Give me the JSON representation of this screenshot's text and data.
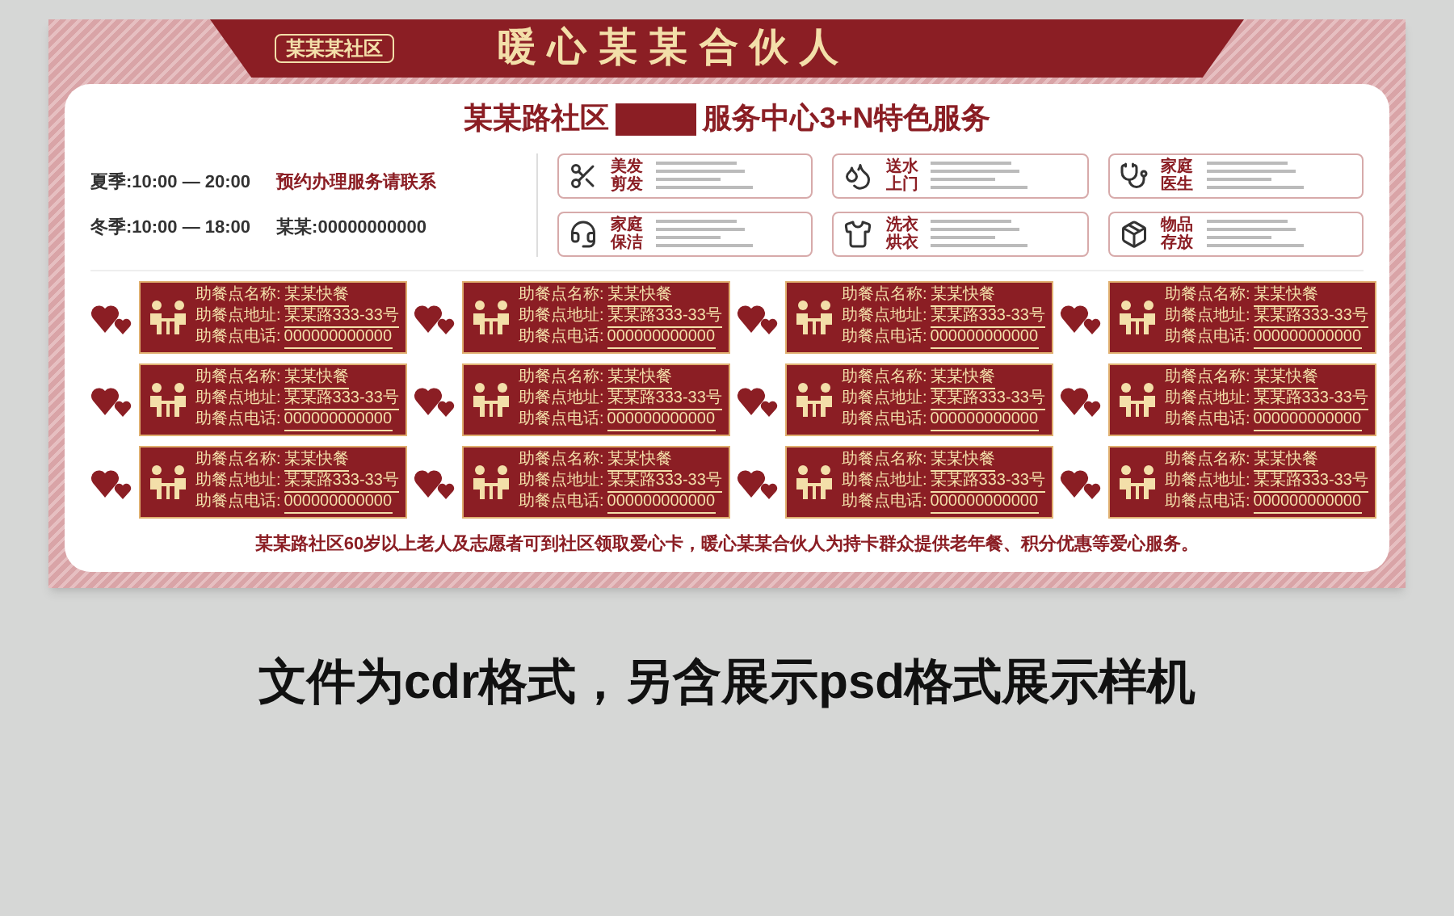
{
  "board": {
    "badge": "某某某社区",
    "title": "暖心某某合伙人",
    "subtitle_left": "某某路社区",
    "subtitle_right": "服务中心3+N特色服务",
    "hours": [
      {
        "time": "夏季:10:00 — 20:00",
        "note": "预约办理服务请联系"
      },
      {
        "time": "冬季:10:00 — 18:00",
        "note": "某某:00000000000"
      }
    ],
    "services": [
      {
        "name": [
          "美发",
          "剪发"
        ]
      },
      {
        "name": [
          "送水",
          "上门"
        ]
      },
      {
        "name": [
          "家庭",
          "医生"
        ]
      },
      {
        "name": [
          "家庭",
          "保洁"
        ]
      },
      {
        "name": [
          "洗衣",
          "烘衣"
        ]
      },
      {
        "name": [
          "物品",
          "存放"
        ]
      }
    ],
    "partners": [
      {
        "name_label": "助餐点名称:",
        "name": "某某快餐",
        "address_label": "助餐点地址:",
        "address": "某某路333-33号",
        "phone_label": "助餐点电话:",
        "phone": "000000000000"
      },
      {
        "name_label": "助餐点名称:",
        "name": "某某快餐",
        "address_label": "助餐点地址:",
        "address": "某某路333-33号",
        "phone_label": "助餐点电话:",
        "phone": "000000000000"
      },
      {
        "name_label": "助餐点名称:",
        "name": "某某快餐",
        "address_label": "助餐点地址:",
        "address": "某某路333-33号",
        "phone_label": "助餐点电话:",
        "phone": "000000000000"
      },
      {
        "name_label": "助餐点名称:",
        "name": "某某快餐",
        "address_label": "助餐点地址:",
        "address": "某某路333-33号",
        "phone_label": "助餐点电话:",
        "phone": "000000000000"
      },
      {
        "name_label": "助餐点名称:",
        "name": "某某快餐",
        "address_label": "助餐点地址:",
        "address": "某某路333-33号",
        "phone_label": "助餐点电话:",
        "phone": "000000000000"
      },
      {
        "name_label": "助餐点名称:",
        "name": "某某快餐",
        "address_label": "助餐点地址:",
        "address": "某某路333-33号",
        "phone_label": "助餐点电话:",
        "phone": "000000000000"
      },
      {
        "name_label": "助餐点名称:",
        "name": "某某快餐",
        "address_label": "助餐点地址:",
        "address": "某某路333-33号",
        "phone_label": "助餐点电话:",
        "phone": "000000000000"
      },
      {
        "name_label": "助餐点名称:",
        "name": "某某快餐",
        "address_label": "助餐点地址:",
        "address": "某某路333-33号",
        "phone_label": "助餐点电话:",
        "phone": "000000000000"
      },
      {
        "name_label": "助餐点名称:",
        "name": "某某快餐",
        "address_label": "助餐点地址:",
        "address": "某某路333-33号",
        "phone_label": "助餐点电话:",
        "phone": "000000000000"
      },
      {
        "name_label": "助餐点名称:",
        "name": "某某快餐",
        "address_label": "助餐点地址:",
        "address": "某某路333-33号",
        "phone_label": "助餐点电话:",
        "phone": "000000000000"
      },
      {
        "name_label": "助餐点名称:",
        "name": "某某快餐",
        "address_label": "助餐点地址:",
        "address": "某某路333-33号",
        "phone_label": "助餐点电话:",
        "phone": "000000000000"
      },
      {
        "name_label": "助餐点名称:",
        "name": "某某快餐",
        "address_label": "助餐点地址:",
        "address": "某某路333-33号",
        "phone_label": "助餐点电话:",
        "phone": "000000000000"
      }
    ],
    "notice": "某某路社区60岁以上老人及志愿者可到社区领取爱心卡，暖心某某合伙人为持卡群众提供老年餐、积分优惠等爱心服务。"
  },
  "caption": "文件为cdr格式，另含展示psd格式展示样机"
}
